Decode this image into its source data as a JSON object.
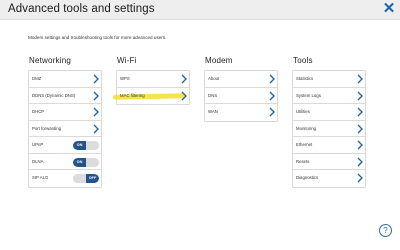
{
  "header": {
    "title": "Advanced tools and settings",
    "close_icon": "close-icon"
  },
  "subtitle": "Modem settings and troubleshooting tools for more advanced users.",
  "colors": {
    "accent": "#1e62a8",
    "toggle_on": "#24548c",
    "highlight": "#f2e02a"
  },
  "columns": {
    "networking": {
      "heading": "Networking",
      "items": [
        {
          "label": "DMZ"
        },
        {
          "label": "DDNS (Dynamic DNS)"
        },
        {
          "label": "DHCP"
        },
        {
          "label": "Port forwarding"
        },
        {
          "label": "UPnP",
          "toggle": {
            "on_label": "ON",
            "off_label": "OFF",
            "state": "on"
          }
        },
        {
          "label": "DLNA",
          "toggle": {
            "on_label": "ON",
            "off_label": "OFF",
            "state": "on"
          }
        },
        {
          "label": "SIP ALG",
          "toggle": {
            "on_label": "ON",
            "off_label": "OFF",
            "state": "off"
          }
        }
      ]
    },
    "wifi": {
      "heading": "Wi-Fi",
      "items": [
        {
          "label": "WPS"
        },
        {
          "label": "MAC filtering",
          "highlighted": true
        }
      ]
    },
    "modem": {
      "heading": "Modem",
      "items": [
        {
          "label": "About"
        },
        {
          "label": "DNS"
        },
        {
          "label": "WAN"
        }
      ]
    },
    "tools": {
      "heading": "Tools",
      "items": [
        {
          "label": "Statistics"
        },
        {
          "label": "System Logs"
        },
        {
          "label": "Utilities"
        },
        {
          "label": "Monitoring"
        },
        {
          "label": "Ethernet"
        },
        {
          "label": "Resets"
        },
        {
          "label": "Diagnostics"
        }
      ]
    }
  },
  "help": {
    "label": "?",
    "icon": "help-icon"
  }
}
